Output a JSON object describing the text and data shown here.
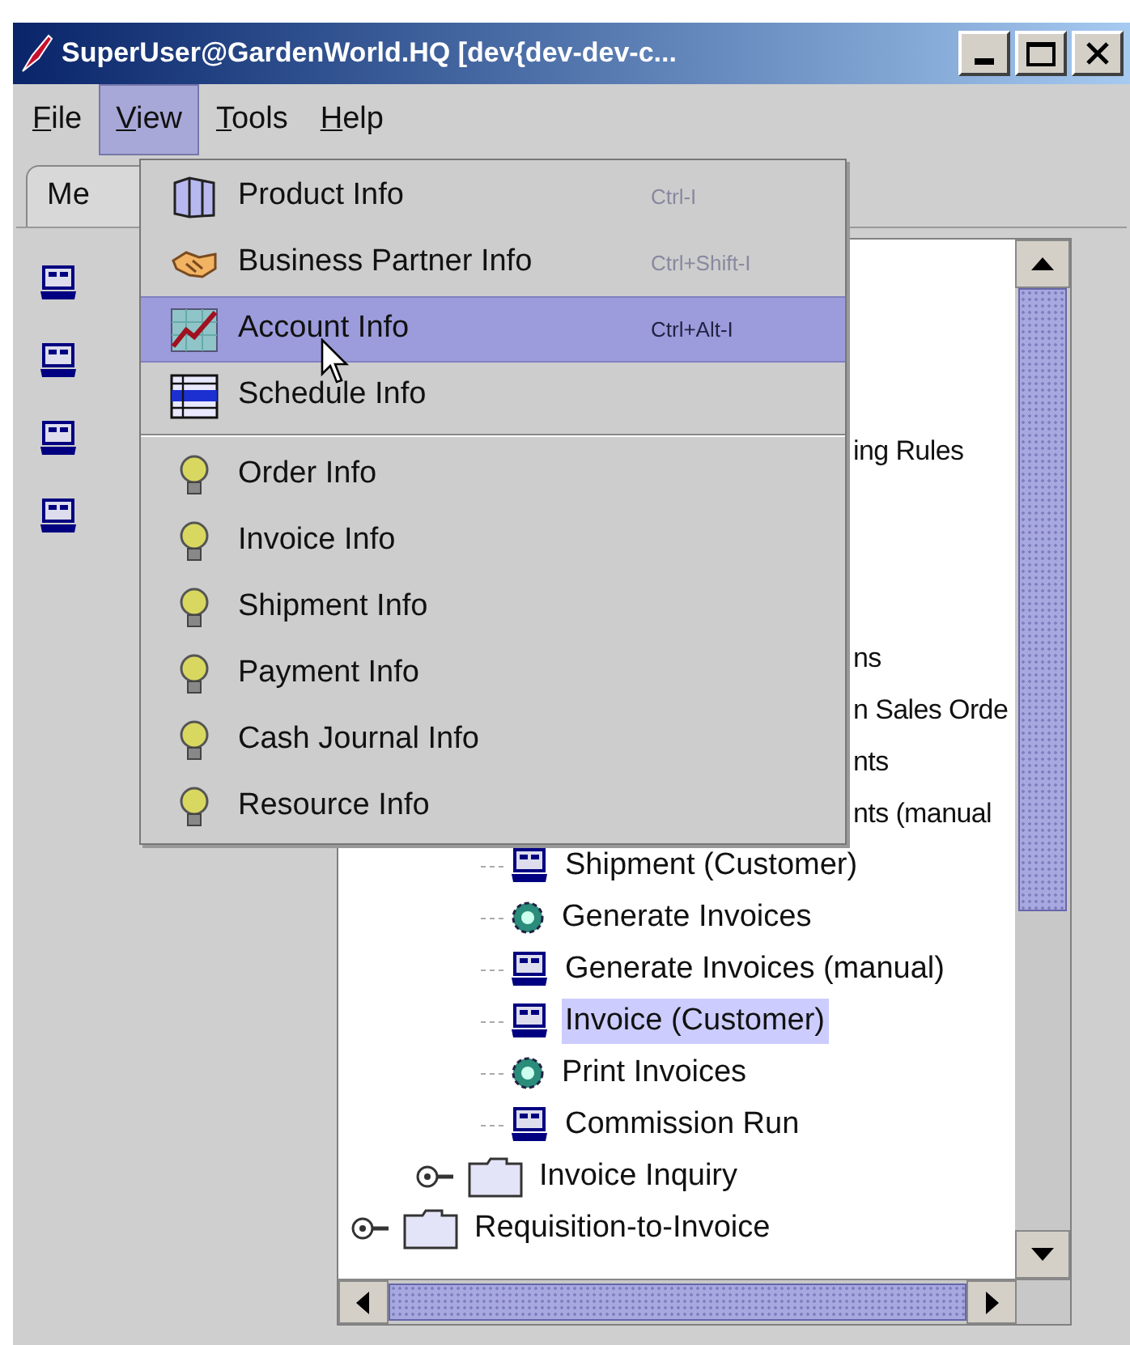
{
  "window": {
    "title": "SuperUser@GardenWorld.HQ [dev{dev-dev-c..."
  },
  "menu_bar": [
    {
      "label": "File",
      "selected": false
    },
    {
      "label": "View",
      "selected": true
    },
    {
      "label": "Tools",
      "selected": false
    },
    {
      "label": "Help",
      "selected": false
    }
  ],
  "tab": {
    "label": "Me"
  },
  "left_list": [
    {
      "kind": "window"
    },
    {
      "kind": "window"
    },
    {
      "kind": "window"
    },
    {
      "kind": "window"
    }
  ],
  "tree": {
    "partial_rows": [
      "ing Rules",
      "ns",
      "n Sales Orde",
      "nts",
      "nts (manual"
    ],
    "items": [
      {
        "children": [
          {
            "children": [
              {
                "label": "Shipment (Customer)",
                "kind": "window",
                "selected": false
              },
              {
                "label": "Generate Invoices",
                "kind": "process",
                "selected": false
              },
              {
                "label": "Generate Invoices (manual)",
                "kind": "window",
                "selected": false
              },
              {
                "label": "Invoice (Customer)",
                "kind": "window",
                "selected": true
              },
              {
                "label": "Print Invoices",
                "kind": "process",
                "selected": false
              },
              {
                "label": "Commission Run",
                "kind": "window",
                "selected": false
              }
            ]
          },
          {
            "label": "Invoice Inquiry",
            "kind": "folder",
            "expanded": false,
            "selected": false
          }
        ]
      },
      {
        "label": "Requisition-to-Invoice",
        "kind": "folder",
        "expanded": false,
        "selected": false
      }
    ]
  },
  "view_menu": {
    "groups": [
      [
        {
          "label": "Product Info",
          "shortcut": "Ctrl-I",
          "kind": "product",
          "selected": false
        },
        {
          "label": "Business Partner Info",
          "shortcut": "Ctrl+Shift-I",
          "kind": "partner",
          "selected": false
        },
        {
          "label": "Account Info",
          "shortcut": "Ctrl+Alt-I",
          "kind": "chart",
          "selected": true
        },
        {
          "label": "Schedule Info",
          "kind": "schedule",
          "selected": false
        }
      ],
      [
        {
          "label": "Order Info",
          "kind": "bulb",
          "selected": false
        },
        {
          "label": "Invoice Info",
          "kind": "bulb",
          "selected": false
        },
        {
          "label": "Shipment Info",
          "kind": "bulb",
          "selected": false
        },
        {
          "label": "Payment Info",
          "kind": "bulb",
          "selected": false
        },
        {
          "label": "Cash Journal Info",
          "kind": "bulb",
          "selected": false
        },
        {
          "label": "Resource Info",
          "kind": "bulb",
          "selected": false
        }
      ]
    ]
  }
}
